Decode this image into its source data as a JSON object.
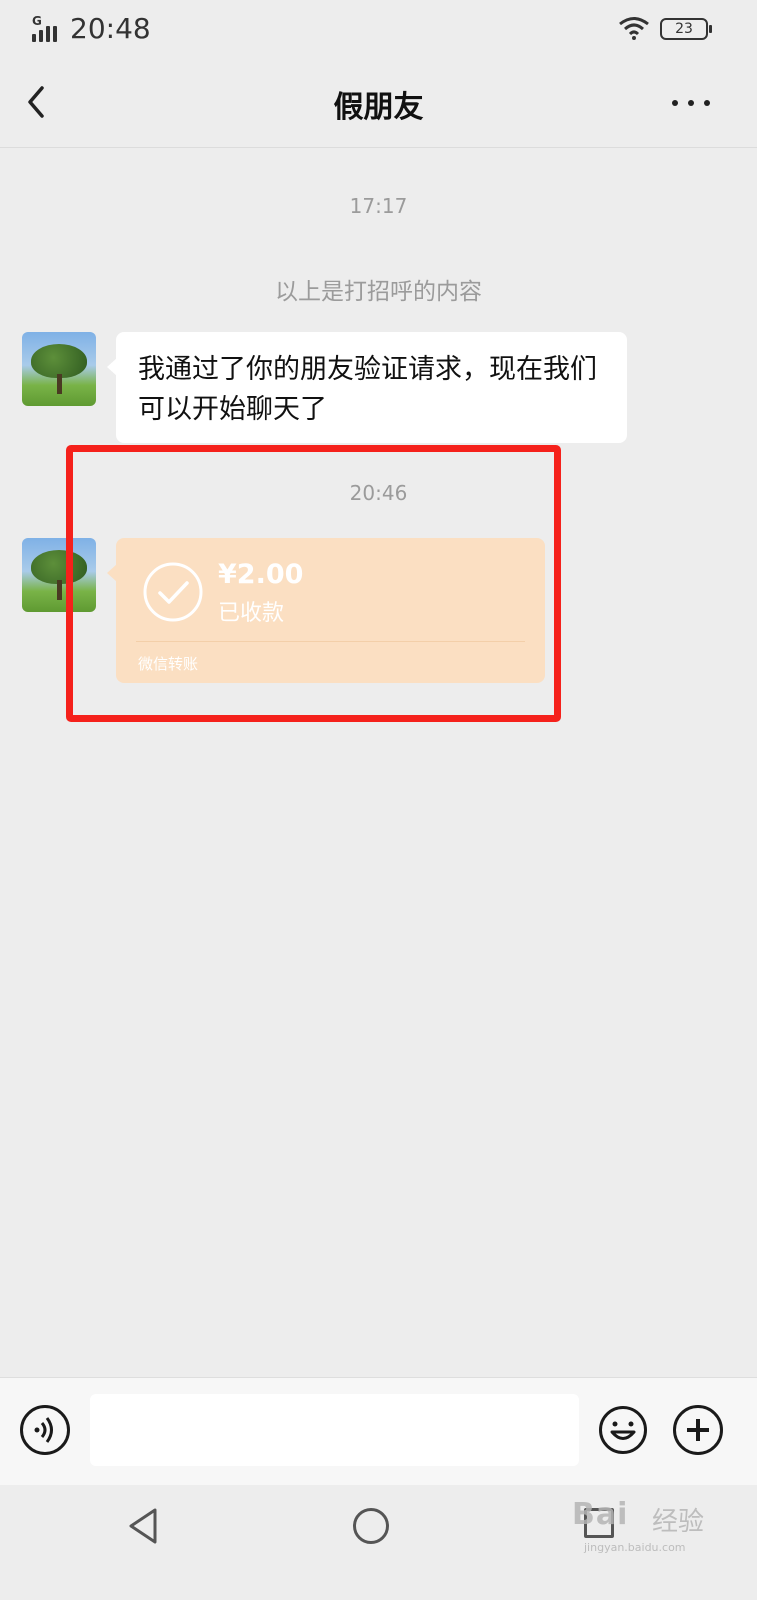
{
  "status_bar": {
    "network": "G",
    "time": "20:48",
    "battery": "23"
  },
  "nav": {
    "title": "假朋友"
  },
  "chat": {
    "timestamp_1": "17:17",
    "system_note": "以上是打招呼的内容",
    "message_1": "我通过了你的朋友验证请求，现在我们可以开始聊天了",
    "timestamp_2": "20:46",
    "transfer": {
      "amount": "¥2.00",
      "status": "已收款",
      "footer": "微信转账"
    }
  },
  "input_bar": {
    "value": ""
  },
  "watermark": {
    "logo": "Bai",
    "name": "经验",
    "url": "jingyan.baidu.com"
  },
  "colors": {
    "background": "#ededed",
    "bubble": "#ffffff",
    "transfer_card": "#fbdfc2",
    "highlight": "#f5211b",
    "muted_text": "#9b9b9b"
  }
}
